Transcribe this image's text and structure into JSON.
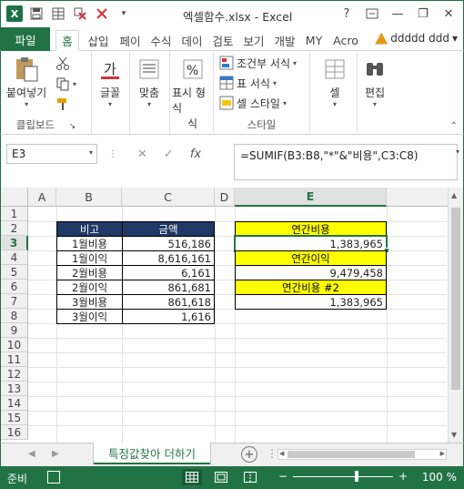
{
  "window": {
    "title": "엑셀함수.xlsx - Excel",
    "help": "?",
    "minimize": "—",
    "restore": "❐",
    "close": "✕"
  },
  "qat": {
    "app_icon": "X",
    "items": [
      "save-icon",
      "table-icon",
      "delete-icon",
      "clear-icon",
      "more-icon"
    ]
  },
  "tabs": [
    "파일",
    "홈",
    "삽입",
    "페이",
    "수식",
    "데이",
    "검토",
    "보기",
    "개발",
    "MY",
    "Acro"
  ],
  "active_tab": "홈",
  "user": {
    "name": "ddddd ddd",
    "caret": "▾"
  },
  "ribbon": {
    "paste_label": "붙여넣기",
    "clipboard_group": "클립보드",
    "font_label": "글꼴",
    "align_label": "맞춤",
    "number_label": "표시 형식",
    "number_sub": "식",
    "cond_format": "조건부 서식",
    "table_format": "표 서식",
    "cell_style": "셀 스타일",
    "style_group": "스타일",
    "cells_label": "셀",
    "edit_label": "편집"
  },
  "formula_bar": {
    "name_box": "E3",
    "cancel": "✕",
    "enter": "✓",
    "fx": "fx",
    "formula": "=SUMIF(B3:B8,\"*\"&\"비용\",C3:C8)"
  },
  "columns": [
    "A",
    "B",
    "C",
    "D",
    "E"
  ],
  "selected_column": "E",
  "rows": [
    "1",
    "2",
    "3",
    "4",
    "5",
    "6",
    "7",
    "8",
    "9",
    "10",
    "11",
    "12",
    "13",
    "14",
    "15",
    "16"
  ],
  "selected_row": "3",
  "table": {
    "headers": [
      "비고",
      "금액"
    ],
    "rows": [
      [
        "1월비용",
        "516,186"
      ],
      [
        "1월이익",
        "8,616,161"
      ],
      [
        "2월비용",
        "6,161"
      ],
      [
        "2월이익",
        "861,681"
      ],
      [
        "3월비용",
        "861,618"
      ],
      [
        "3월이익",
        "1,616"
      ]
    ]
  },
  "summary": {
    "label1": "연간비용",
    "value1": "1,383,965",
    "label2": "연간이익",
    "value2": "9,479,458",
    "label3": "연간비용 #2",
    "value3": "1,383,965"
  },
  "sheet": {
    "tab_name": "특정값찾아 더하기",
    "add": "+"
  },
  "status": {
    "ready": "준비",
    "zoom": "100 %",
    "zoom_level": 100,
    "minus": "−",
    "plus": "+"
  },
  "colors": {
    "accent": "#217346",
    "header_navy": "#1f3864",
    "highlight": "#ffff00"
  }
}
